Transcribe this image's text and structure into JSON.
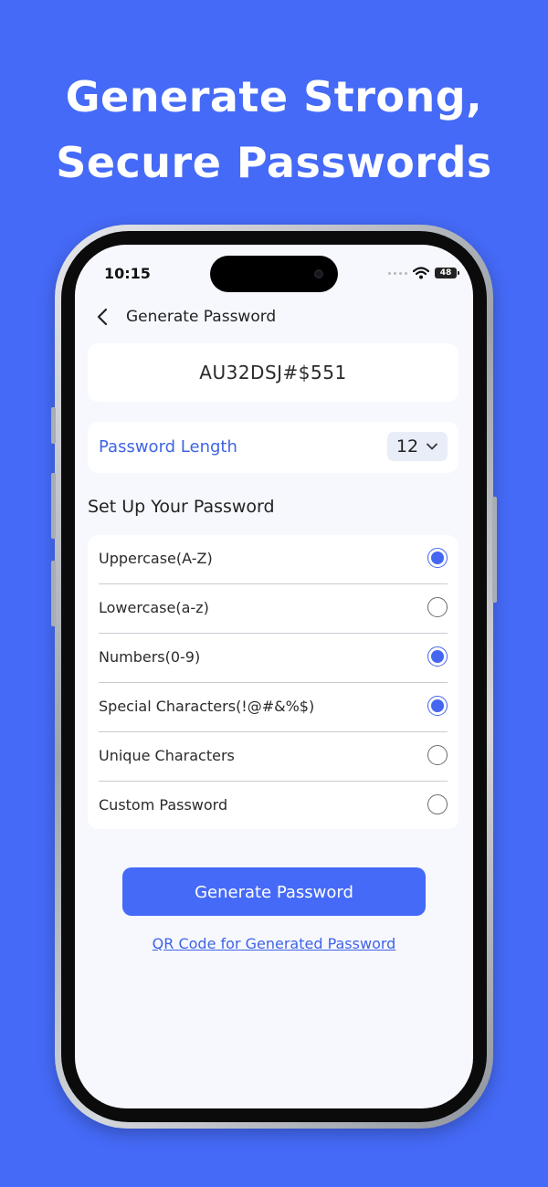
{
  "headline": {
    "line1": "Generate Strong,",
    "line2": "Secure Passwords"
  },
  "status_bar": {
    "time": "10:15",
    "battery": "48"
  },
  "nav": {
    "title": "Generate Password"
  },
  "password": {
    "value": "AU32DSJ#$551"
  },
  "length": {
    "label": "Password Length",
    "value": "12"
  },
  "section": {
    "title": "Set Up Your Password"
  },
  "options": [
    {
      "label": "Uppercase(A-Z)",
      "checked": true
    },
    {
      "label": "Lowercase(a-z)",
      "checked": false
    },
    {
      "label": "Numbers(0-9)",
      "checked": true
    },
    {
      "label": "Special Characters(!@#&%$)",
      "checked": true
    },
    {
      "label": "Unique Characters",
      "checked": false
    },
    {
      "label": "Custom Password",
      "checked": false
    }
  ],
  "actions": {
    "generate_label": "Generate Password",
    "qr_link": "QR Code for Generated Password"
  },
  "colors": {
    "background": "#456AF7",
    "accent": "#4466F0",
    "screen": "#F6F8FE"
  },
  "icons": [
    "back-chevron-icon",
    "chevron-down-icon",
    "wifi-icon",
    "battery-icon"
  ]
}
